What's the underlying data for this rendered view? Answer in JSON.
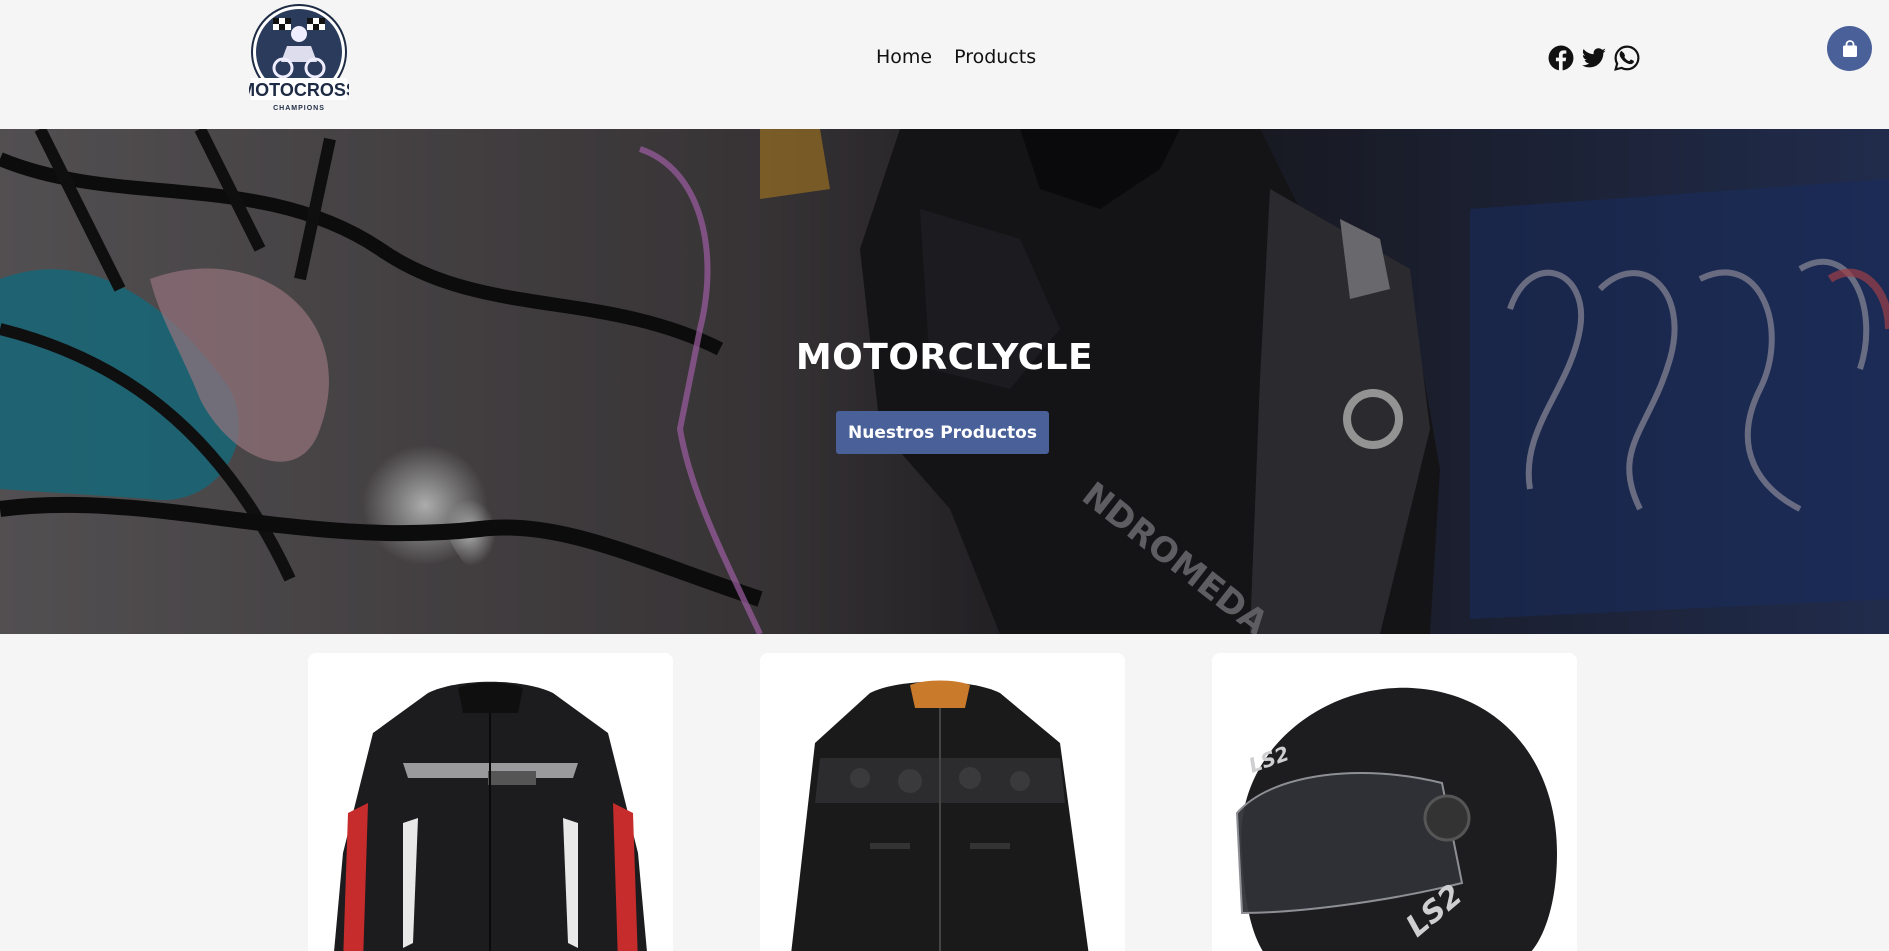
{
  "header": {
    "logo": {
      "text_main": "MOTOCROSS",
      "text_sub": "CHAMPIONS"
    },
    "nav": [
      {
        "label": "Home"
      },
      {
        "label": "Products"
      }
    ],
    "socials": [
      {
        "icon": "facebook-icon"
      },
      {
        "icon": "twitter-icon"
      },
      {
        "icon": "whatsapp-icon"
      }
    ],
    "cart_icon": "shopping-bag-icon"
  },
  "hero": {
    "title": "MOTORCLYCLE",
    "button_label": "Nuestros Productos"
  },
  "products": [
    {
      "image": "textile-motorcycle-jacket-black-red"
    },
    {
      "image": "leather-motorcycle-jacket-black"
    },
    {
      "image": "matte-black-full-face-helmet"
    }
  ],
  "colors": {
    "accent": "#4a6099",
    "background": "#f5f5f5",
    "card": "#ffffff"
  }
}
